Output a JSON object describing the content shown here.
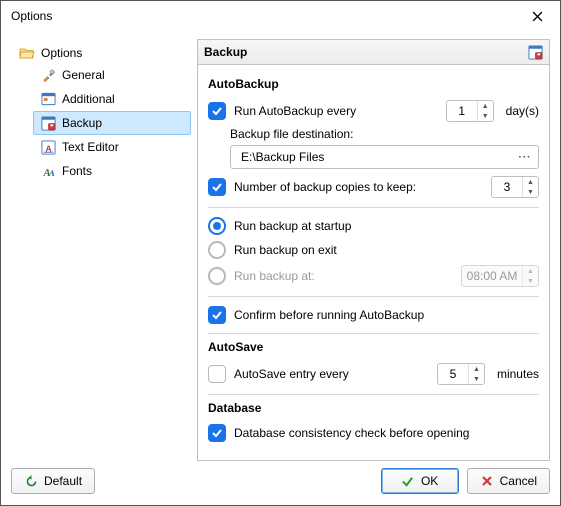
{
  "window": {
    "title": "Options"
  },
  "tree": {
    "root": "Options",
    "items": [
      {
        "label": "General"
      },
      {
        "label": "Additional"
      },
      {
        "label": "Backup",
        "selected": true
      },
      {
        "label": "Text Editor"
      },
      {
        "label": "Fonts"
      }
    ]
  },
  "panel": {
    "title": "Backup"
  },
  "sections": {
    "autobackup": {
      "title": "AutoBackup",
      "run_every_label": "Run AutoBackup every",
      "run_every_value": "1",
      "run_every_unit": "day(s)",
      "dest_label": "Backup file destination:",
      "dest_value": "E:\\Backup Files",
      "copies_label": "Number of backup copies to keep:",
      "copies_value": "3",
      "radio_startup": "Run backup at startup",
      "radio_exit": "Run backup on exit",
      "radio_at": "Run backup at:",
      "radio_at_time": "08:00 AM",
      "confirm_label": "Confirm before running AutoBackup"
    },
    "autosave": {
      "title": "AutoSave",
      "every_label": "AutoSave entry every",
      "every_value": "5",
      "every_unit": "minutes"
    },
    "database": {
      "title": "Database",
      "consistency_label": "Database consistency check before opening"
    }
  },
  "buttons": {
    "default": "Default",
    "ok": "OK",
    "cancel": "Cancel"
  }
}
